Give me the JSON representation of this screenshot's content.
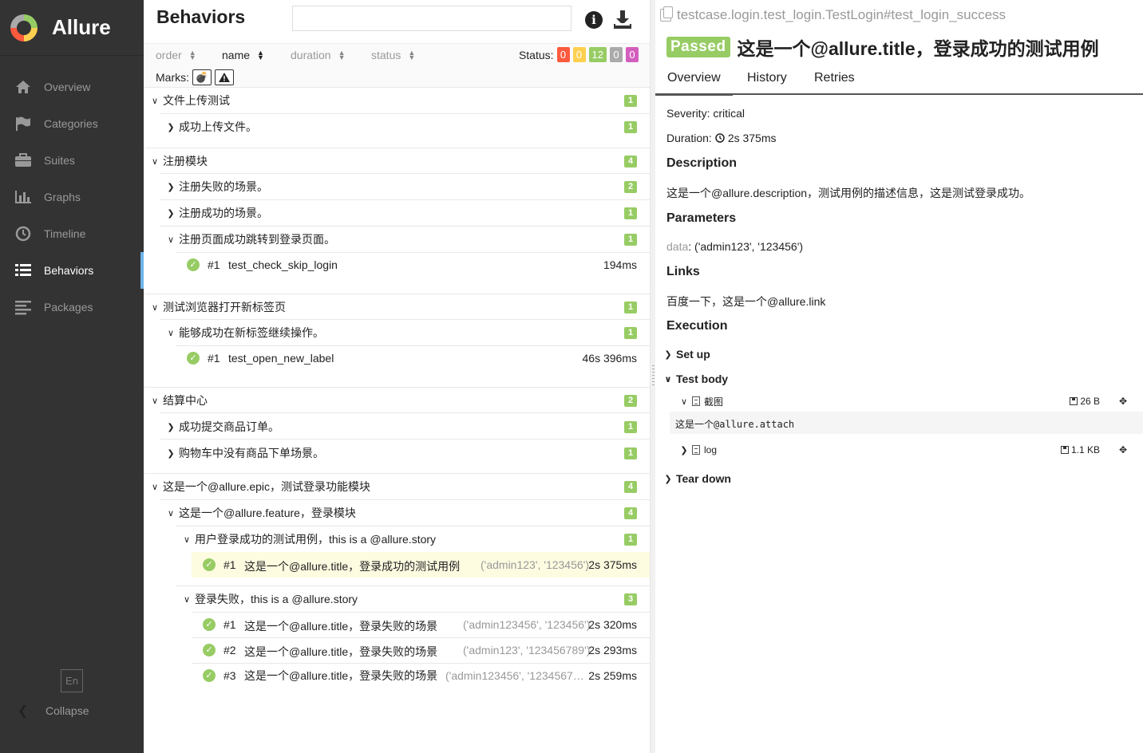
{
  "sidebar": {
    "brand": "Allure",
    "items": [
      {
        "label": "Overview",
        "icon": "home-icon"
      },
      {
        "label": "Categories",
        "icon": "flag-icon"
      },
      {
        "label": "Suites",
        "icon": "briefcase-icon"
      },
      {
        "label": "Graphs",
        "icon": "bar-chart-icon"
      },
      {
        "label": "Timeline",
        "icon": "clock-icon"
      },
      {
        "label": "Behaviors",
        "icon": "list-icon"
      },
      {
        "label": "Packages",
        "icon": "align-left-icon"
      }
    ],
    "active": "Behaviors",
    "lang": "En",
    "collapse": "Collapse"
  },
  "middle": {
    "title": "Behaviors",
    "search_value": "",
    "sort": {
      "order": "order",
      "name": "name",
      "duration": "duration",
      "status": "status"
    },
    "status_label": "Status:",
    "status_counts": [
      {
        "value": "0",
        "color": "#fd5a3e"
      },
      {
        "value": "0",
        "color": "#ffd050"
      },
      {
        "value": "12",
        "color": "#97cc64"
      },
      {
        "value": "0",
        "color": "#aaaaaa"
      },
      {
        "value": "0",
        "color": "#d35ebe"
      }
    ],
    "marks_label": "Marks:",
    "tree": {
      "g1": {
        "label": "文件上传测试",
        "count": "1"
      },
      "g1a": {
        "label": "成功上传文件。",
        "count": "1"
      },
      "g2": {
        "label": "注册模块",
        "count": "4"
      },
      "g2a": {
        "label": "注册失败的场景。",
        "count": "2"
      },
      "g2b": {
        "label": "注册成功的场景。",
        "count": "1"
      },
      "g2c": {
        "label": "注册页面成功跳转到登录页面。",
        "count": "1"
      },
      "t1": {
        "num": "#1",
        "name": "test_check_skip_login",
        "params": "",
        "duration": "194ms"
      },
      "g3": {
        "label": "测试浏览器打开新标签页",
        "count": "1"
      },
      "g3a": {
        "label": "能够成功在新标签继续操作。",
        "count": "1"
      },
      "t2": {
        "num": "#1",
        "name": "test_open_new_label",
        "params": "",
        "duration": "46s 396ms"
      },
      "g4": {
        "label": "结算中心",
        "count": "2"
      },
      "g4a": {
        "label": "成功提交商品订单。",
        "count": "1"
      },
      "g4b": {
        "label": "购物车中没有商品下单场景。",
        "count": "1"
      },
      "g5": {
        "label": "这是一个@allure.epic，测试登录功能模块",
        "count": "4"
      },
      "g5a": {
        "label": "这是一个@allure.feature，登录模块",
        "count": "4"
      },
      "g5a1": {
        "label": "用户登录成功的测试用例，this is a @allure.story",
        "count": "1"
      },
      "t3": {
        "num": "#1",
        "name": "这是一个@allure.title，登录成功的测试用例",
        "params": "('admin123', '123456')",
        "duration": "2s 375ms"
      },
      "g5a2": {
        "label": "登录失败，this is a @allure.story",
        "count": "3"
      },
      "t4": {
        "num": "#1",
        "name": "这是一个@allure.title，登录失败的场景",
        "params": "('admin123456', '123456')",
        "duration": "2s 320ms"
      },
      "t5": {
        "num": "#2",
        "name": "这是一个@allure.title，登录失败的场景",
        "params": "('admin123', '123456789')",
        "duration": "2s 293ms"
      },
      "t6": {
        "num": "#3",
        "name": "这是一个@allure.title，登录失败的场景",
        "params": "('admin123456', '1234567…",
        "duration": "2s 259ms"
      }
    }
  },
  "detail": {
    "breadcrumb": "testcase.login.test_login.TestLogin#test_login_success",
    "status": "Passed",
    "title": "这是一个@allure.title，登录成功的测试用例",
    "tabs": [
      "Overview",
      "History",
      "Retries"
    ],
    "severity": "Severity: critical",
    "duration_label": "Duration:",
    "duration": "2s 375ms",
    "description_heading": "Description",
    "description": "这是一个@allure.description，测试用例的描述信息，这是测试登录成功。",
    "parameters_heading": "Parameters",
    "param_name": "data",
    "param_value": ": ('admin123', '123456')",
    "links_heading": "Links",
    "link": "百度一下，这是一个@allure.link",
    "execution_heading": "Execution",
    "setup": "Set up",
    "test_body": "Test body",
    "attachment1": {
      "name": "截图",
      "size": "26 B"
    },
    "attachment1_content": "这是一个@allure.attach",
    "attachment2": {
      "name": "log",
      "size": "1.1 KB"
    },
    "teardown": "Tear down"
  },
  "colors": {
    "passed": "#97cc64",
    "sidebar": "#333333",
    "selected_row": "#fdfbe0"
  }
}
